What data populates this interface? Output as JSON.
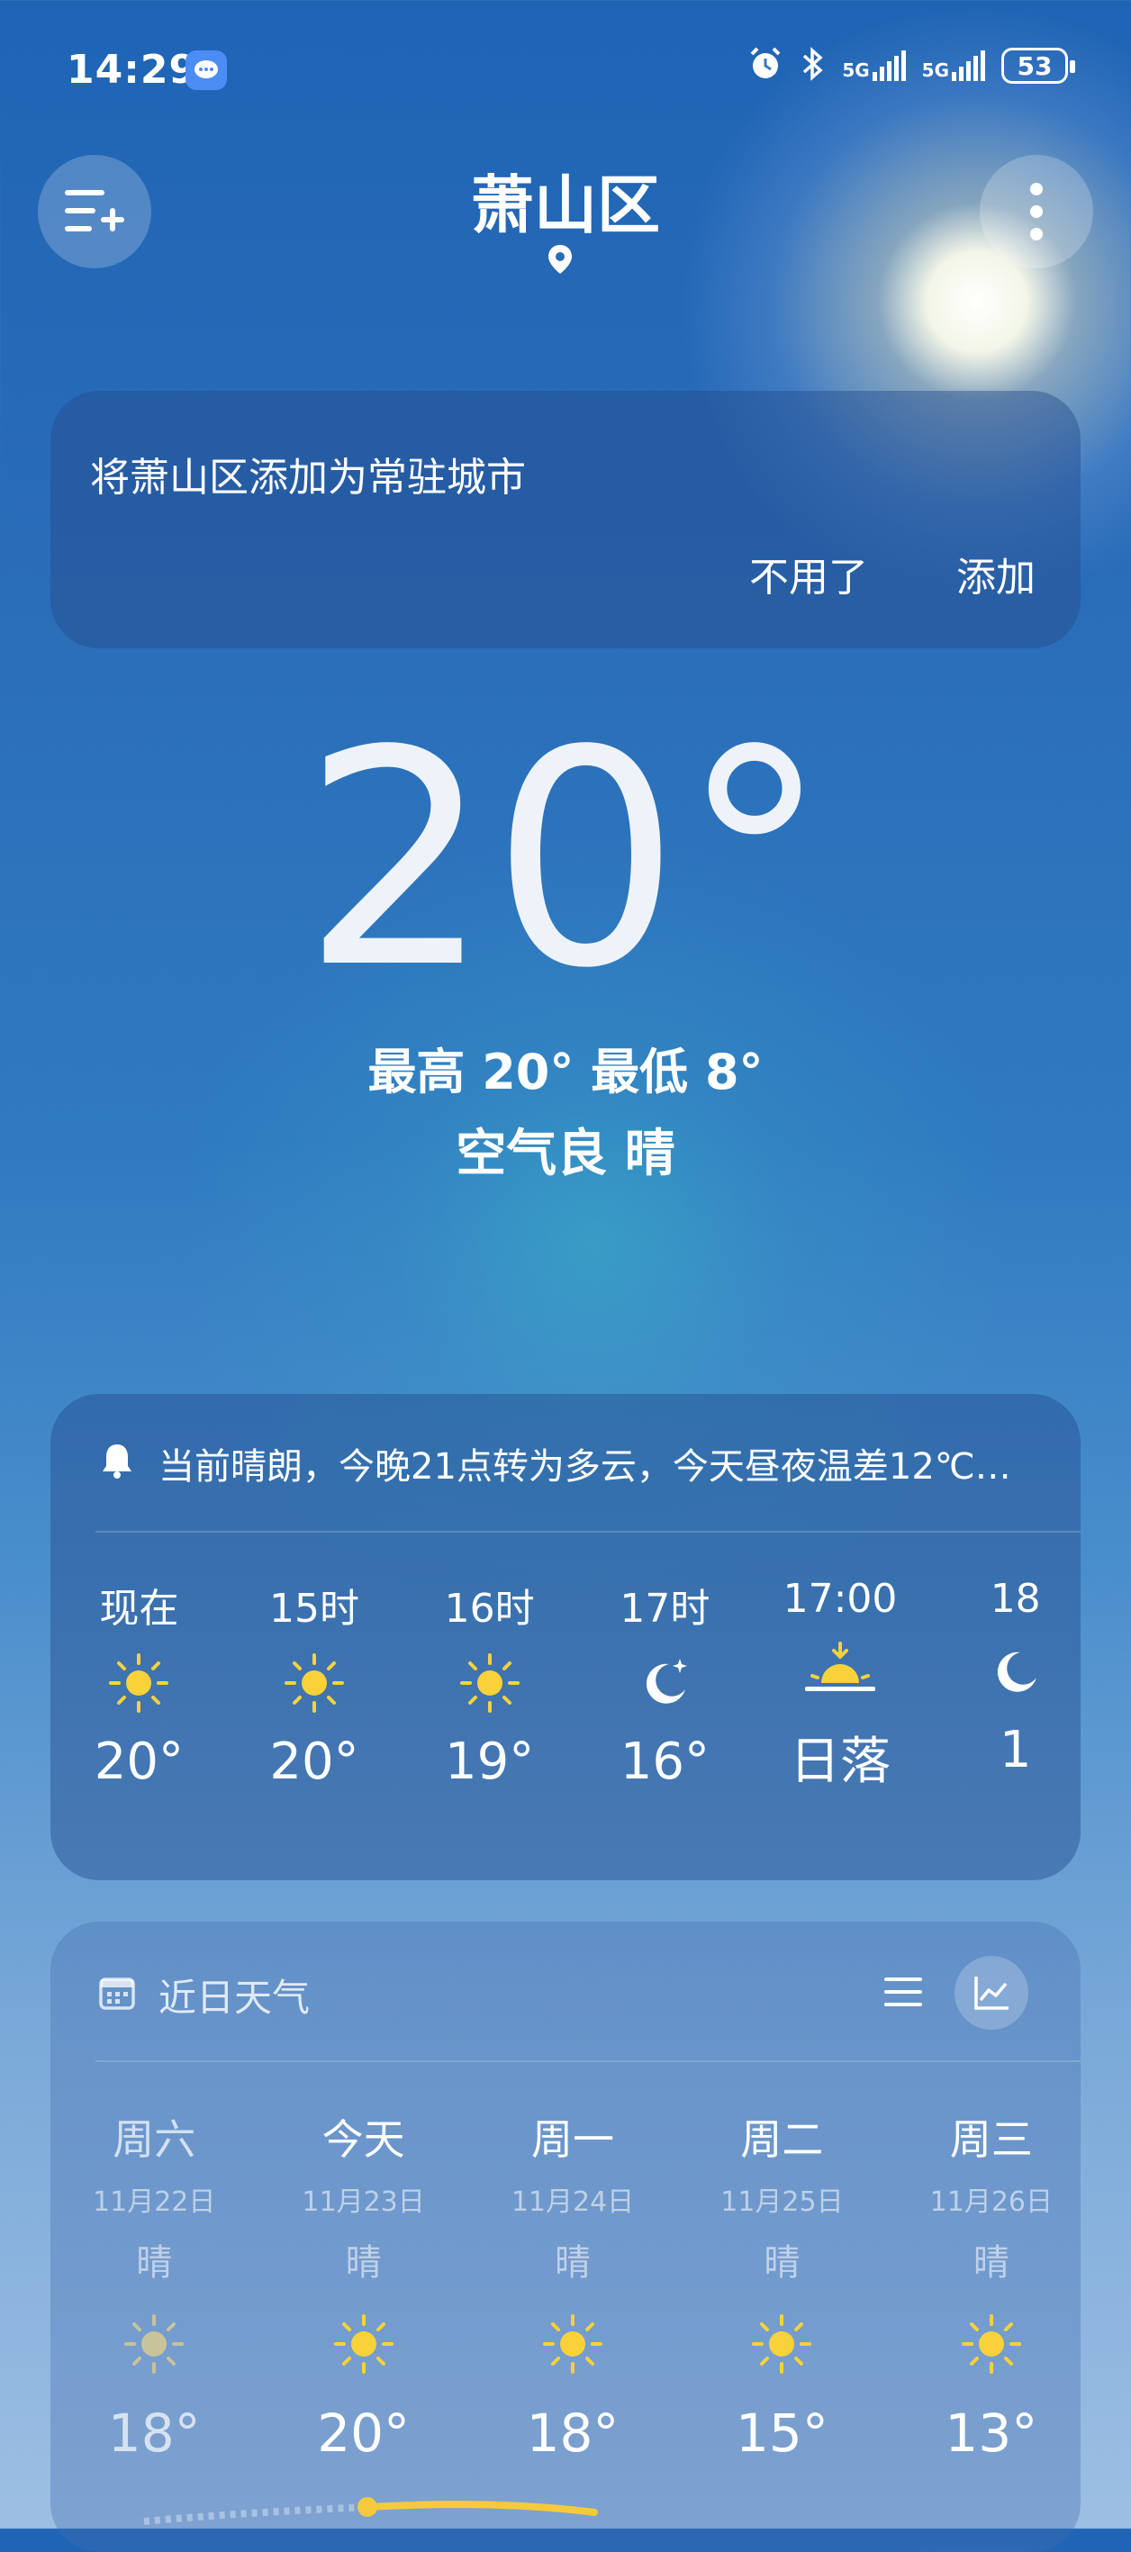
{
  "status_bar": {
    "time": "14:29",
    "battery": "53",
    "signal1": "5G",
    "signal2": "5G"
  },
  "header": {
    "city": "萧山区"
  },
  "banner": {
    "text": "将萧山区添加为常驻城市",
    "dismiss": "不用了",
    "add": "添加"
  },
  "current": {
    "temperature": "20°",
    "hilo": "最高 20° 最低 8°",
    "air_condition": "空气良  晴"
  },
  "hourly": {
    "alert": "当前晴朗，今晚21点转为多云，今天昼夜温差12℃…",
    "items": [
      {
        "time": "现在",
        "icon": "sun-icon",
        "temp": "20°"
      },
      {
        "time": "15时",
        "icon": "sun-icon",
        "temp": "20°"
      },
      {
        "time": "16时",
        "icon": "sun-icon",
        "temp": "19°"
      },
      {
        "time": "17时",
        "icon": "moon-icon",
        "temp": "16°"
      },
      {
        "time": "17:00",
        "icon": "sunset-icon",
        "temp": "日落"
      },
      {
        "time": "18",
        "icon": "moon-icon",
        "temp": "1"
      }
    ]
  },
  "daily": {
    "title": "近日天气",
    "items": [
      {
        "day": "周六",
        "date": "11月22日",
        "cond": "晴",
        "temp": "18°",
        "icon": "sun-icon"
      },
      {
        "day": "今天",
        "date": "11月23日",
        "cond": "晴",
        "temp": "20°",
        "icon": "sun-icon"
      },
      {
        "day": "周一",
        "date": "11月24日",
        "cond": "晴",
        "temp": "18°",
        "icon": "sun-icon"
      },
      {
        "day": "周二",
        "date": "11月25日",
        "cond": "晴",
        "temp": "15°",
        "icon": "sun-icon"
      },
      {
        "day": "周三",
        "date": "11月26日",
        "cond": "晴",
        "temp": "13°",
        "icon": "sun-icon"
      }
    ]
  },
  "colors": {
    "sun": "#f9d23a",
    "accent_line": "#f7c93c"
  }
}
